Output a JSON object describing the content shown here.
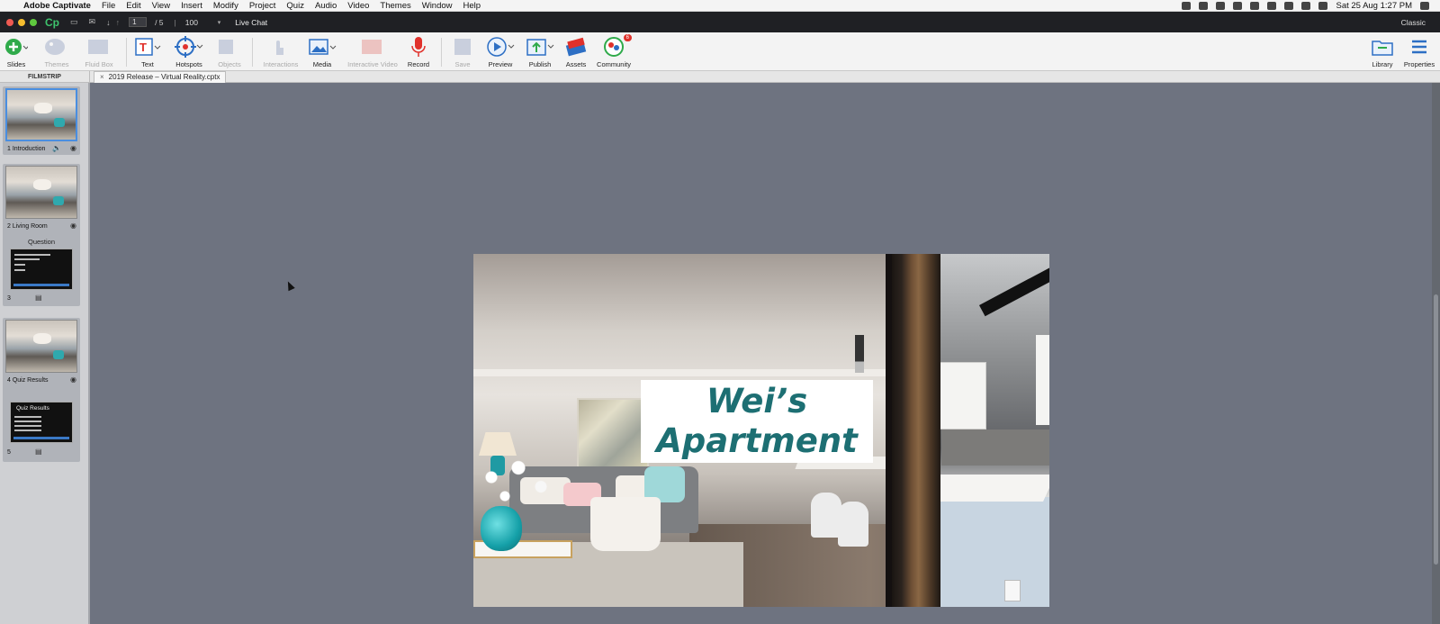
{
  "menubar": {
    "app_name": "Adobe Captivate",
    "items": [
      "File",
      "Edit",
      "View",
      "Insert",
      "Modify",
      "Project",
      "Quiz",
      "Audio",
      "Video",
      "Themes",
      "Window",
      "Help"
    ],
    "clock": "Sat 25 Aug  1:27 PM"
  },
  "titlebar": {
    "logo": "Cp",
    "current_slide": "1",
    "total_slides": "/ 5",
    "divider": "|",
    "zoom": "100",
    "live_chat": "Live Chat",
    "workspace": "Classic"
  },
  "toolbar": {
    "slides": "Slides",
    "themes": "Themes",
    "fluid_box": "Fluid Box",
    "text": "Text",
    "hotspots": "Hotspots",
    "objects": "Objects",
    "interactions": "Interactions",
    "media": "Media",
    "interactive_video": "Interactive Video",
    "record": "Record",
    "save": "Save",
    "preview": "Preview",
    "publish": "Publish",
    "assets": "Assets",
    "community": "Community",
    "community_badge": "6",
    "library": "Library",
    "properties": "Properties"
  },
  "tabs": {
    "filmstrip_title": "FILMSTRIP",
    "doc_close": "×",
    "doc_title": "2019 Release – Virtual Reality.cptx"
  },
  "filmstrip": {
    "slide1_label": "1 Introduction",
    "slide2_label": "2 Living Room",
    "question_group": "Question",
    "slide3_label": "3",
    "slide4_label": "4 Quiz Results",
    "slide5_label": "5",
    "slide5_thumb_title": "Quiz Results"
  },
  "slide": {
    "title_line1": "Wei’s",
    "title_line2": "Apartment"
  },
  "colors": {
    "accent": "#1d6f73",
    "stage_bg": "#6e7380",
    "selection": "#4a8ee0",
    "badge": "#e0312b"
  }
}
